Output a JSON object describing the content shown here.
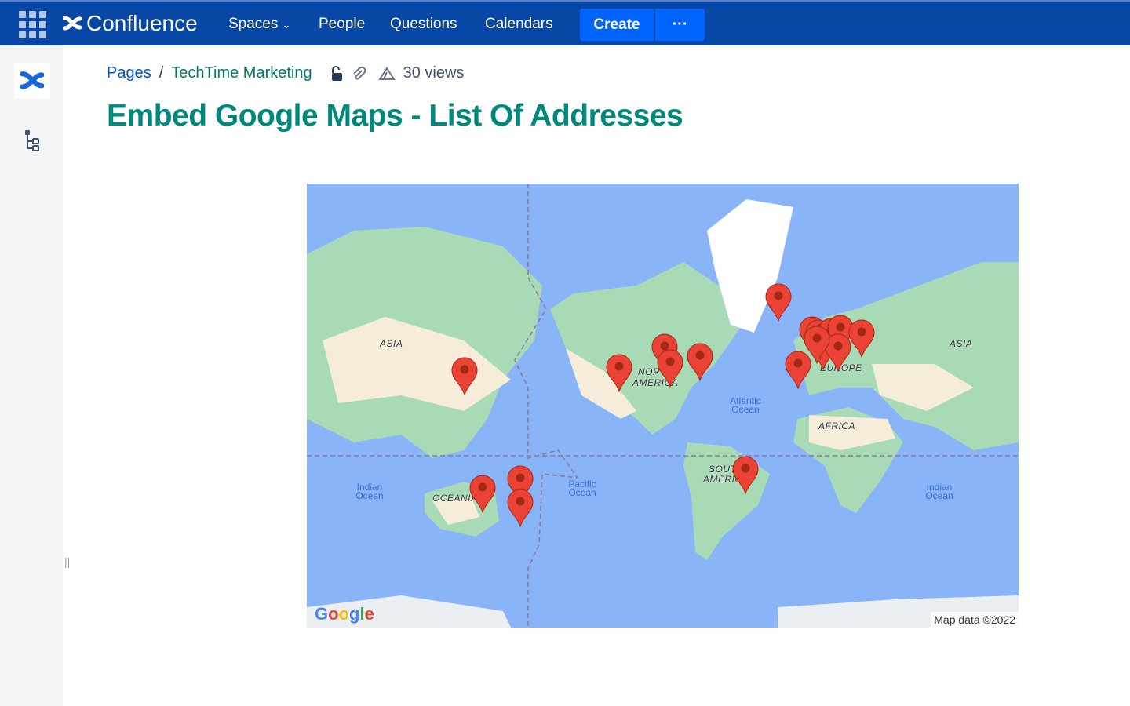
{
  "topbar": {
    "app_name": "Confluence",
    "nav": [
      "Spaces",
      "People",
      "Questions",
      "Calendars"
    ],
    "create_label": "Create",
    "more_label": "···"
  },
  "breadcrumb": {
    "root": "Pages",
    "separator": "/",
    "space": "TechTime Marketing",
    "views": "30 views"
  },
  "page": {
    "title": "Embed Google Maps - List Of Addresses"
  },
  "map": {
    "labels": {
      "asia_left": "ASIA",
      "asia_right": "ASIA",
      "north_america_1": "NORTH",
      "north_america_2": "AMERICA",
      "europe": "EUROPE",
      "africa": "AFRICA",
      "south_america_1": "SOUTH",
      "south_america_2": "AMERICA",
      "oceania": "OCEANIA"
    },
    "oceans": {
      "atlantic": "Atlantic Ocean",
      "pacific": "Pacific Ocean",
      "indian_left": "Indian Ocean",
      "indian_right": "Indian Ocean"
    },
    "google_logo": "Google",
    "attribution": "Map data ©2022",
    "marker_count": 20,
    "marker_color": "#ea4335"
  },
  "colors": {
    "topbar": "#0747a6",
    "create": "#0065ff",
    "title": "#00897b",
    "link": "#0052cc"
  }
}
